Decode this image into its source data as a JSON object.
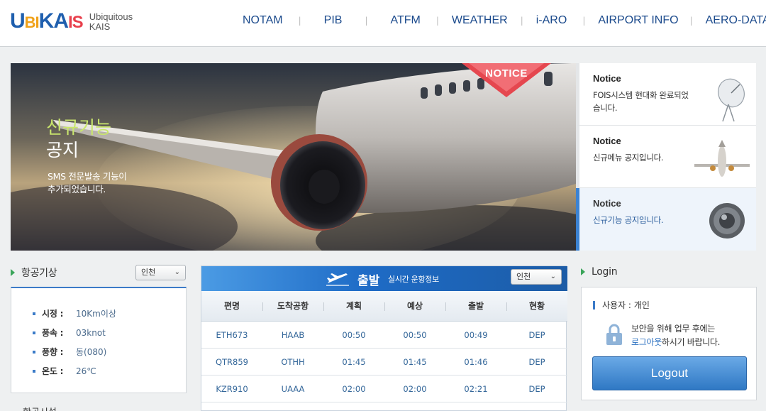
{
  "brand": {
    "logo_text": "UBIKAIS",
    "subtitle_line1": "Ubiquitous",
    "subtitle_line2": "KAIS"
  },
  "nav": {
    "items": [
      "NOTAM",
      "PIB",
      "ATFM",
      "WEATHER",
      "i-ARO",
      "AIRPORT INFO",
      "AERO-DATA"
    ]
  },
  "banner": {
    "ribbon": "NOTICE",
    "title_line1": "신규기능",
    "title_line2": "공지",
    "desc_line1": "SMS 전문발송 기능이",
    "desc_line2": "추가되었습니다."
  },
  "notices": [
    {
      "title": "Notice",
      "line1": "FOIS시스템 현대화 완료되었",
      "line2": "습니다.",
      "icon": "satellite-dish-icon"
    },
    {
      "title": "Notice",
      "line1": "신규메뉴 공지입니다.",
      "line2": "",
      "icon": "airplane-icon"
    },
    {
      "title": "Notice",
      "line1": "신규기능 공지입니다.",
      "line2": "",
      "icon": "speaker-icon"
    }
  ],
  "weather": {
    "title": "항공기상",
    "airport": "인천",
    "rows": [
      {
        "label": "시정 :",
        "value": "10Km이상"
      },
      {
        "label": "풍속 :",
        "value": "03knot"
      },
      {
        "label": "풍향 :",
        "value": "동(080)"
      },
      {
        "label": "온도 :",
        "value": "26℃"
      }
    ]
  },
  "next_section_title": "항공시설",
  "flights": {
    "title": "출발",
    "subtitle": "실시간 운항정보",
    "airport": "인천",
    "columns": [
      "편명",
      "도착공항",
      "계획",
      "예상",
      "출발",
      "현황"
    ],
    "rows": [
      [
        "ETH673",
        "HAAB",
        "00:50",
        "00:50",
        "00:49",
        "DEP"
      ],
      [
        "QTR859",
        "OTHH",
        "01:45",
        "01:45",
        "01:46",
        "DEP"
      ],
      [
        "KZR910",
        "UAAA",
        "02:00",
        "02:00",
        "02:21",
        "DEP"
      ]
    ]
  },
  "login": {
    "title": "Login",
    "user_type": "사용자 : 개인",
    "msg_line1": "보안을 위해 업무 후에는",
    "msg_link": "로그아웃",
    "msg_line2_rest": "하시기 바랍니다.",
    "logout_label": "Logout"
  },
  "colors": {
    "brand_blue": "#1b4a8c",
    "accent_green": "#3aa55a",
    "notice_red": "#e5474f",
    "primary_blue": "#2f78c4"
  }
}
